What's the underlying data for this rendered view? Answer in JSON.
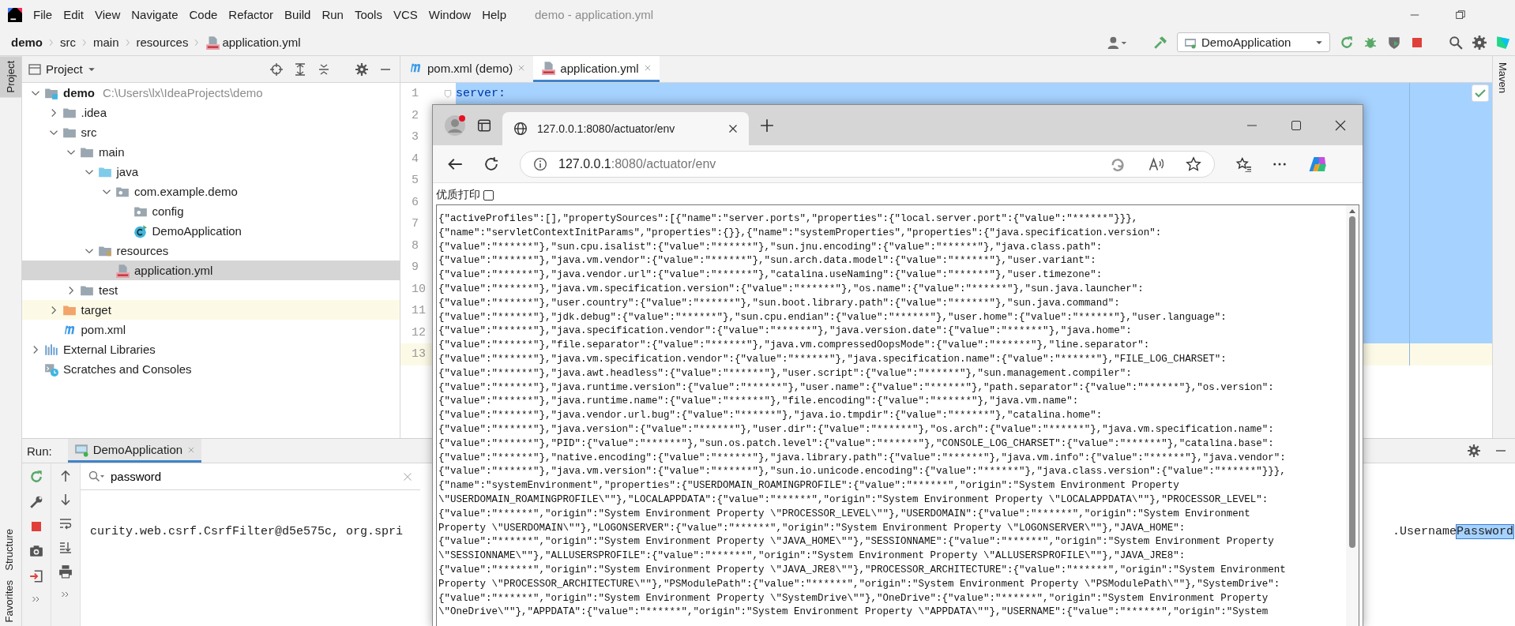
{
  "ide": {
    "menu": [
      "File",
      "Edit",
      "View",
      "Navigate",
      "Code",
      "Refactor",
      "Build",
      "Run",
      "Tools",
      "VCS",
      "Window",
      "Help"
    ],
    "title": "demo - application.yml",
    "breadcrumbs": [
      "demo",
      "src",
      "main",
      "resources",
      "application.yml"
    ],
    "run_config": "DemoApplication",
    "left_strip": {
      "top": "Project",
      "bottom": [
        "Structure",
        "Favorites"
      ]
    },
    "right_strip": "Maven",
    "project_panel": {
      "title": "Project",
      "tree": [
        {
          "label": "demo",
          "kind": "module",
          "path": "C:\\Users\\lx\\IdeaProjects\\demo",
          "expanded": true,
          "selected": false,
          "children": [
            {
              "label": ".idea",
              "kind": "folder",
              "expanded": false,
              "selected": false
            },
            {
              "label": "src",
              "kind": "folder",
              "expanded": true,
              "selected": false,
              "children": [
                {
                  "label": "main",
                  "kind": "folder",
                  "expanded": true,
                  "selected": false,
                  "children": [
                    {
                      "label": "java",
                      "kind": "source-folder",
                      "expanded": true,
                      "selected": false,
                      "children": [
                        {
                          "label": "com.example.demo",
                          "kind": "package",
                          "expanded": true,
                          "selected": false,
                          "children": [
                            {
                              "label": "config",
                              "kind": "package",
                              "selected": false
                            },
                            {
                              "label": "DemoApplication",
                              "kind": "class",
                              "selected": false
                            }
                          ]
                        }
                      ]
                    },
                    {
                      "label": "resources",
                      "kind": "resources",
                      "expanded": true,
                      "selected": false,
                      "children": [
                        {
                          "label": "application.yml",
                          "kind": "yml",
                          "selected": true
                        }
                      ]
                    }
                  ]
                },
                {
                  "label": "test",
                  "kind": "folder",
                  "expanded": false,
                  "selected": false
                }
              ]
            },
            {
              "label": "target",
              "kind": "excluded",
              "expanded": false,
              "selected": false
            },
            {
              "label": "pom.xml",
              "kind": "maven",
              "selected": false
            }
          ]
        },
        {
          "label": "External Libraries",
          "kind": "libraries",
          "expanded": false,
          "selected": false
        },
        {
          "label": "Scratches and Consoles",
          "kind": "scratches",
          "selected": false
        }
      ]
    },
    "editor": {
      "tabs": [
        {
          "label": "pom.xml (demo)",
          "kind": "maven",
          "selected": false
        },
        {
          "label": "application.yml",
          "kind": "yml",
          "selected": true
        }
      ],
      "lines": [
        {
          "number": "1",
          "code": "server:",
          "selected": true
        },
        {
          "number": "2",
          "selected": true
        },
        {
          "number": "3",
          "selected": true
        },
        {
          "number": "4",
          "selected": true
        },
        {
          "number": "5",
          "selected": true
        },
        {
          "number": "6",
          "selected": true
        },
        {
          "number": "7",
          "selected": true
        },
        {
          "number": "8",
          "selected": true
        },
        {
          "number": "9",
          "selected": true
        },
        {
          "number": "10",
          "selected": true
        },
        {
          "number": "11",
          "selected": true
        },
        {
          "number": "12",
          "selected": true
        },
        {
          "number": "13",
          "selected": false
        }
      ]
    },
    "run_panel": {
      "label": "Run:",
      "tab": "DemoApplication",
      "search": "password",
      "console_left": "curity.web.csrf.CsrfFilter@d5e575c, org.spri",
      "console_right": ".Username",
      "console_match": "Password"
    }
  },
  "browser": {
    "tab_title": "127.0.0.1:8080/actuator/env",
    "url_host": "127.0.0.1",
    "url_rest": ":8080/actuator/env",
    "print_label": "优质打印",
    "print_checked": false,
    "body_lines": [
      "{\"activeProfiles\":[],\"propertySources\":[{\"name\":\"server.ports\",\"properties\":{\"local.server.port\":{\"value\":\"******\"}}},",
      "{\"name\":\"servletContextInitParams\",\"properties\":{}},{\"name\":\"systemProperties\",\"properties\":{\"java.specification.version\":",
      "{\"value\":\"******\"},\"sun.cpu.isalist\":{\"value\":\"******\"},\"sun.jnu.encoding\":{\"value\":\"******\"},\"java.class.path\":",
      "{\"value\":\"******\"},\"java.vm.vendor\":{\"value\":\"******\"},\"sun.arch.data.model\":{\"value\":\"******\"},\"user.variant\":",
      "{\"value\":\"******\"},\"java.vendor.url\":{\"value\":\"******\"},\"catalina.useNaming\":{\"value\":\"******\"},\"user.timezone\":",
      "{\"value\":\"******\"},\"java.vm.specification.version\":{\"value\":\"******\"},\"os.name\":{\"value\":\"******\"},\"sun.java.launcher\":",
      "{\"value\":\"******\"},\"user.country\":{\"value\":\"******\"},\"sun.boot.library.path\":{\"value\":\"******\"},\"sun.java.command\":",
      "{\"value\":\"******\"},\"jdk.debug\":{\"value\":\"******\"},\"sun.cpu.endian\":{\"value\":\"******\"},\"user.home\":{\"value\":\"******\"},\"user.language\":",
      "{\"value\":\"******\"},\"java.specification.vendor\":{\"value\":\"******\"},\"java.version.date\":{\"value\":\"******\"},\"java.home\":",
      "{\"value\":\"******\"},\"file.separator\":{\"value\":\"******\"},\"java.vm.compressedOopsMode\":{\"value\":\"******\"},\"line.separator\":",
      "{\"value\":\"******\"},\"java.vm.specification.vendor\":{\"value\":\"******\"},\"java.specification.name\":{\"value\":\"******\"},\"FILE_LOG_CHARSET\":",
      "{\"value\":\"******\"},\"java.awt.headless\":{\"value\":\"******\"},\"user.script\":{\"value\":\"******\"},\"sun.management.compiler\":",
      "{\"value\":\"******\"},\"java.runtime.version\":{\"value\":\"******\"},\"user.name\":{\"value\":\"******\"},\"path.separator\":{\"value\":\"******\"},\"os.version\":",
      "{\"value\":\"******\"},\"java.runtime.name\":{\"value\":\"******\"},\"file.encoding\":{\"value\":\"******\"},\"java.vm.name\":",
      "{\"value\":\"******\"},\"java.vendor.url.bug\":{\"value\":\"******\"},\"java.io.tmpdir\":{\"value\":\"******\"},\"catalina.home\":",
      "{\"value\":\"******\"},\"java.version\":{\"value\":\"******\"},\"user.dir\":{\"value\":\"******\"},\"os.arch\":{\"value\":\"******\"},\"java.vm.specification.name\":",
      "{\"value\":\"******\"},\"PID\":{\"value\":\"******\"},\"sun.os.patch.level\":{\"value\":\"******\"},\"CONSOLE_LOG_CHARSET\":{\"value\":\"******\"},\"catalina.base\":",
      "{\"value\":\"******\"},\"native.encoding\":{\"value\":\"******\"},\"java.library.path\":{\"value\":\"******\"},\"java.vm.info\":{\"value\":\"******\"},\"java.vendor\":",
      "{\"value\":\"******\"},\"java.vm.version\":{\"value\":\"******\"},\"sun.io.unicode.encoding\":{\"value\":\"******\"},\"java.class.version\":{\"value\":\"******\"}}},",
      "{\"name\":\"systemEnvironment\",\"properties\":{\"USERDOMAIN_ROAMINGPROFILE\":{\"value\":\"******\",\"origin\":\"System Environment Property",
      "\\\"USERDOMAIN_ROAMINGPROFILE\\\"\"},\"LOCALAPPDATA\":{\"value\":\"******\",\"origin\":\"System Environment Property \\\"LOCALAPPDATA\\\"\"},\"PROCESSOR_LEVEL\":",
      "{\"value\":\"******\",\"origin\":\"System Environment Property \\\"PROCESSOR_LEVEL\\\"\"},\"USERDOMAIN\":{\"value\":\"******\",\"origin\":\"System Environment",
      "Property \\\"USERDOMAIN\\\"\"},\"LOGONSERVER\":{\"value\":\"******\",\"origin\":\"System Environment Property \\\"LOGONSERVER\\\"\"},\"JAVA_HOME\":",
      "{\"value\":\"******\",\"origin\":\"System Environment Property \\\"JAVA_HOME\\\"\"},\"SESSIONNAME\":{\"value\":\"******\",\"origin\":\"System Environment Property",
      "\\\"SESSIONNAME\\\"\"},\"ALLUSERSPROFILE\":{\"value\":\"******\",\"origin\":\"System Environment Property \\\"ALLUSERSPROFILE\\\"\"},\"JAVA_JRE8\":",
      "{\"value\":\"******\",\"origin\":\"System Environment Property \\\"JAVA_JRE8\\\"\"},\"PROCESSOR_ARCHITECTURE\":{\"value\":\"******\",\"origin\":\"System Environment",
      "Property \\\"PROCESSOR_ARCHITECTURE\\\"\"},\"PSModulePath\":{\"value\":\"******\",\"origin\":\"System Environment Property \\\"PSModulePath\\\"\"},\"SystemDrive\":",
      "{\"value\":\"******\",\"origin\":\"System Environment Property \\\"SystemDrive\\\"\"},\"OneDrive\":{\"value\":\"******\",\"origin\":\"System Environment Property",
      "\\\"OneDrive\\\"\"},\"APPDATA\":{\"value\":\"******\",\"origin\":\"System Environment Property \\\"APPDATA\\\"\"},\"USERNAME\":{\"value\":\"******\",\"origin\":\"System"
    ]
  }
}
